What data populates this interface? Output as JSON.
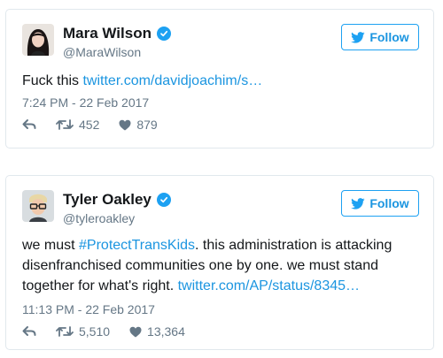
{
  "follow_label": "Follow",
  "colors": {
    "accent": "#1da1f2",
    "link": "#1b95e0",
    "muted": "#657786",
    "border": "#e1e8ed"
  },
  "tweets": [
    {
      "name": "Mara Wilson",
      "handle": "@MaraWilson",
      "verified": true,
      "text_before": "Fuck this ",
      "link": "twitter.com/davidjoachim/s…",
      "text_mid": "",
      "link2": "",
      "text_after": "",
      "timestamp": "7:24 PM - 22 Feb 2017",
      "retweets": "452",
      "likes": "879",
      "icons": {
        "reply": "reply-icon",
        "retweet": "retweet-icon",
        "like": "heart-icon"
      }
    },
    {
      "name": "Tyler Oakley",
      "handle": "@tyleroakley",
      "verified": true,
      "text_before": "we must ",
      "link": "#ProtectTransKids",
      "text_mid": ". this administration is attacking disenfranchised communities one by one. we must stand together for what's right. ",
      "link2": "twitter.com/AP/status/8345…",
      "text_after": "",
      "timestamp": "11:13 PM - 22 Feb 2017",
      "retweets": "5,510",
      "likes": "13,364",
      "icons": {
        "reply": "reply-icon",
        "retweet": "retweet-icon",
        "like": "heart-icon"
      }
    }
  ]
}
